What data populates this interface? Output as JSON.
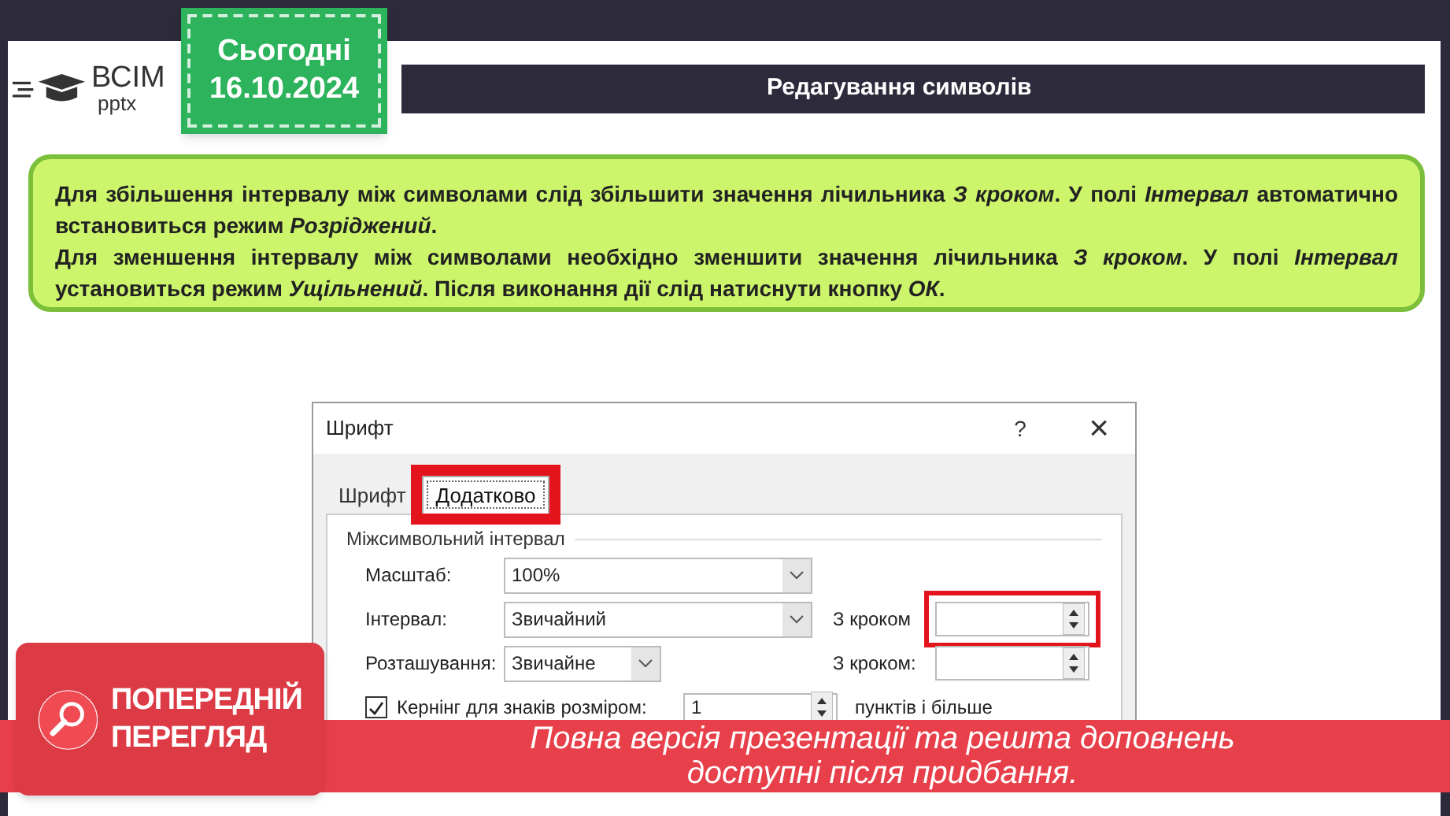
{
  "logo": {
    "name": "ВСІМ",
    "sub": "pptx"
  },
  "date_badge": {
    "label": "Сьогодні",
    "date": "16.10.2024"
  },
  "title": "Редагування символів",
  "info_box": {
    "paragraphs": [
      "Для збільшення інтервалу між символами слід збільшити значення лічильника *З кроком*. У полі *Інтервал* автоматично встановиться режим *Розріджений*.",
      "Для зменшення інтервалу між символами необхідно зменшити значення лічильника *З кроком*. У полі *Інтервал* установиться режим *Ущільнений*. Після виконання дії слід натиснути кнопку *ОК*."
    ]
  },
  "dialog": {
    "title": "Шрифт",
    "help": "?",
    "close": "×",
    "tabs": [
      {
        "label": "Шрифт",
        "selected": false,
        "highlighted": false
      },
      {
        "label": "Додатково",
        "selected": true,
        "highlighted": true
      }
    ],
    "section": "Міжсимвольний інтервал",
    "rows": [
      {
        "kind": "combo",
        "label": "Масштаб:",
        "value": "100%"
      },
      {
        "kind": "combo",
        "label": "Інтервал:",
        "value": "Звичайний",
        "side": {
          "label": "З кроком",
          "highlighted": true
        }
      },
      {
        "kind": "short_combo",
        "label": "Розташування:",
        "value": "Звичайне",
        "side": {
          "label": "З кроком:",
          "highlighted": false
        }
      },
      {
        "kind": "checkbox",
        "checked": true,
        "label": "Кернінг для знаків розміром:",
        "value": "1",
        "suffix": "пунктів і більше"
      }
    ]
  },
  "preview_banner": {
    "badge_lines": [
      "ПОПЕРЕДНІЙ",
      "ПЕРЕГЛЯД"
    ],
    "message_lines": [
      "Повна версія презентації та решта доповнень",
      "доступні після придбання."
    ]
  }
}
